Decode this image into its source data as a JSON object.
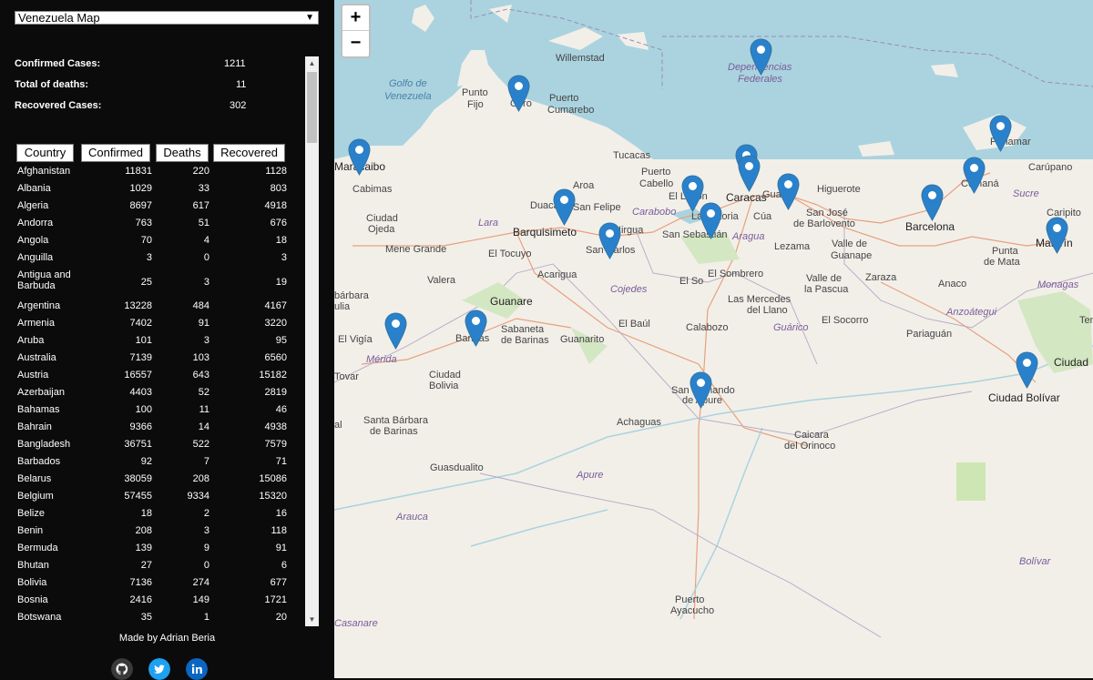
{
  "sidebar": {
    "map_select": "Venezuela Map",
    "stats": {
      "confirmed_label": "Confirmed Cases:",
      "confirmed_value": "1211",
      "deaths_label": "Total of deaths:",
      "deaths_value": "11",
      "recovered_label": "Recovered Cases:",
      "recovered_value": "302"
    },
    "table": {
      "headers": [
        "Country",
        "Confirmed",
        "Deaths",
        "Recovered"
      ],
      "rows": [
        [
          "Afghanistan",
          "11831",
          "220",
          "1128"
        ],
        [
          "Albania",
          "1029",
          "33",
          "803"
        ],
        [
          "Algeria",
          "8697",
          "617",
          "4918"
        ],
        [
          "Andorra",
          "763",
          "51",
          "676"
        ],
        [
          "Angola",
          "70",
          "4",
          "18"
        ],
        [
          "Anguilla",
          "3",
          "0",
          "3"
        ],
        [
          "Antigua and Barbuda",
          "25",
          "3",
          "19"
        ],
        [
          "Argentina",
          "13228",
          "484",
          "4167"
        ],
        [
          "Armenia",
          "7402",
          "91",
          "3220"
        ],
        [
          "Aruba",
          "101",
          "3",
          "95"
        ],
        [
          "Australia",
          "7139",
          "103",
          "6560"
        ],
        [
          "Austria",
          "16557",
          "643",
          "15182"
        ],
        [
          "Azerbaijan",
          "4403",
          "52",
          "2819"
        ],
        [
          "Bahamas",
          "100",
          "11",
          "46"
        ],
        [
          "Bahrain",
          "9366",
          "14",
          "4938"
        ],
        [
          "Bangladesh",
          "36751",
          "522",
          "7579"
        ],
        [
          "Barbados",
          "92",
          "7",
          "71"
        ],
        [
          "Belarus",
          "38059",
          "208",
          "15086"
        ],
        [
          "Belgium",
          "57455",
          "9334",
          "15320"
        ],
        [
          "Belize",
          "18",
          "2",
          "16"
        ],
        [
          "Benin",
          "208",
          "3",
          "118"
        ],
        [
          "Bermuda",
          "139",
          "9",
          "91"
        ],
        [
          "Bhutan",
          "27",
          "0",
          "6"
        ],
        [
          "Bolivia",
          "7136",
          "274",
          "677"
        ],
        [
          "Bosnia",
          "2416",
          "149",
          "1721"
        ],
        [
          "Botswana",
          "35",
          "1",
          "20"
        ]
      ]
    },
    "credit": "Made by Adrian Beria",
    "social": [
      "github-icon",
      "twitter-icon",
      "linkedin-icon"
    ]
  },
  "map": {
    "zoom_in": "+",
    "zoom_out": "−",
    "labels": {
      "willemstad": "Willemstad",
      "dependencias": "Dependencias",
      "federales": "Federales",
      "golfo1": "Golfo de",
      "golfo2": "Venezuela",
      "punto1": "Punto",
      "punto2": "Fijo",
      "coro": "Coro",
      "puerto_cumarebo1": "Puerto",
      "puerto_cumarebo2": "Cumarebo",
      "porlamar": "Porlamar",
      "carupano": "Carúpano",
      "tucacas": "Tucacas",
      "puerto_cabello1": "Puerto",
      "puerto_cabello2": "Cabello",
      "maracaibo": "Maracaibo",
      "cabimas": "Cabimas",
      "aroa": "Aroa",
      "duaca": "Duaca",
      "san_felipe": "San Felipe",
      "el_limon": "El Limón",
      "caracas": "Caracas",
      "guarenas": "Gua",
      "higuerote": "Higuerote",
      "cumana": "Cumaná",
      "sucre": "Sucre",
      "carabobo": "Carabobo",
      "la_victoria": "La Victoria",
      "cua": "Cúa",
      "san_jose1": "San José",
      "san_jose2": "de Barlovento",
      "barcelona": "Barcelona",
      "caripito": "Caripito",
      "maturin": "Maturín",
      "ciudad_ojeda1": "Ciudad",
      "ciudad_ojeda2": "Ojeda",
      "lara": "Lara",
      "barquisimeto": "Barquisimeto",
      "nirgua": "Nirgua",
      "san_carlos": "San Carlos",
      "san_sebastian": "San Sebastián",
      "aragua": "Aragua",
      "lezama": "Lezama",
      "valle_guanape1": "Valle de",
      "valle_guanape2": "Guanape",
      "punta_mata1": "Punta",
      "punta_mata2": "de Mata",
      "mene_grande": "Mene Grande",
      "el_tocuyo": "El Tocuyo",
      "acarigua": "Acarigua",
      "el_sombrero": "El Sombrero",
      "el_sosa": "El So",
      "valle_pascua1": "Valle de",
      "valle_pascua2": "la Pascua",
      "zaraza": "Zaraza",
      "anaco": "Anaco",
      "monagas": "Monagas",
      "valera": "Valera",
      "guanare": "Guanare",
      "cojedes": "Cojedes",
      "las_mercedes1": "Las Mercedes",
      "las_mercedes2": "del Llano",
      "anzoategui": "Anzoátegui",
      "barbara1": "bárbara",
      "barbara2": "ulia",
      "el_vigia": "El Vigía",
      "sabaneta1": "Sabaneta",
      "sabaneta2": "de Barinas",
      "guanarito": "Guanarito",
      "el_baul": "El Baúl",
      "calabozo": "Calabozo",
      "guarico": "Guárico",
      "el_socorro": "El Socorro",
      "pariaguan": "Pariaguán",
      "merida": "Mérida",
      "barinas": "Barinas",
      "tovar": "Tovar",
      "ciudad_bolivia1": "Ciudad",
      "ciudad_bolivia2": "Bolivia",
      "san_fernando1": "San Fernando",
      "san_fernando2": "de Apure",
      "ciudad_edge": "Ciudad",
      "ciudad_bolivar": "Ciudad Bolívar",
      "tem": "Tem",
      "santa_barbara1": "Santa Bárbara",
      "santa_barbara2": "de Barinas",
      "achaguas": "Achaguas",
      "caicara1": "Caicara",
      "caicara2": "del Orinoco",
      "guasdualito": "Guasdualito",
      "apure": "Apure",
      "arauca": "Arauca",
      "bolivar": "Bolívar",
      "puerto_ayacucho1": "Puerto",
      "puerto_ayacucho2": "Ayacucho",
      "casanare": "Casanare",
      "al": "al"
    },
    "marker_color": "#2a81cb"
  }
}
